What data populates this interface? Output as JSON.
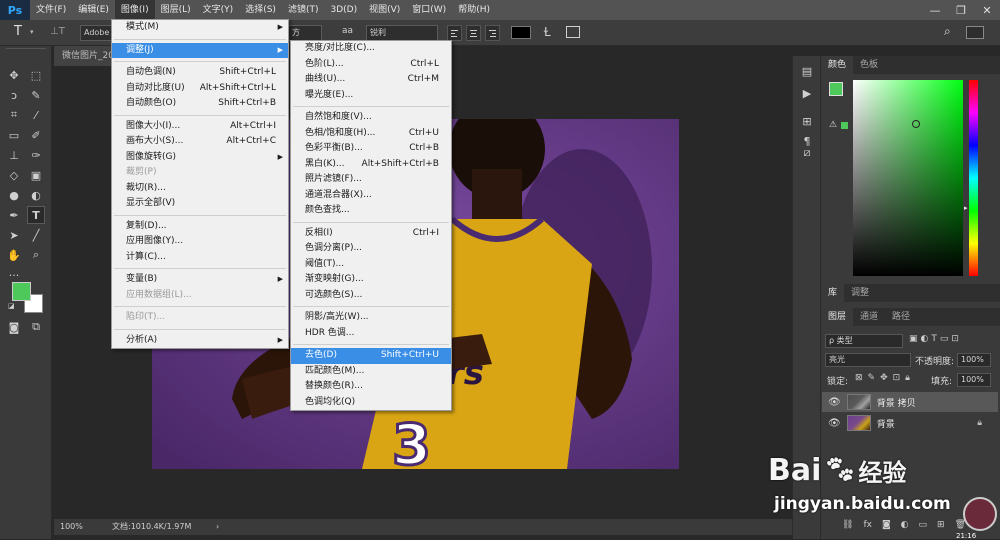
{
  "menubar": {
    "logo": "Ps",
    "items": [
      "文件(F)",
      "编辑(E)",
      "图像(I)",
      "图层(L)",
      "文字(Y)",
      "选择(S)",
      "滤镜(T)",
      "3D(D)",
      "视图(V)",
      "窗口(W)",
      "帮助(H)"
    ]
  },
  "options": {
    "tool_letter": "T",
    "font_family": "Adobe 黑",
    "font_style_partial": "方",
    "aa_icon_text": "aa",
    "antialias": "锐利"
  },
  "document": {
    "tab_title": "微信图片_20",
    "zoom": "100%",
    "doc_info": "文档:1010.4K/1.97M"
  },
  "image_menu": [
    {
      "label": "模式(M)",
      "sub": true
    },
    {
      "sep": true
    },
    {
      "label": "调整(J)",
      "sub": true,
      "hl": true
    },
    {
      "sep": true
    },
    {
      "label": "自动色调(N)",
      "sc": "Shift+Ctrl+L"
    },
    {
      "label": "自动对比度(U)",
      "sc": "Alt+Shift+Ctrl+L"
    },
    {
      "label": "自动颜色(O)",
      "sc": "Shift+Ctrl+B"
    },
    {
      "sep": true
    },
    {
      "label": "图像大小(I)...",
      "sc": "Alt+Ctrl+I"
    },
    {
      "label": "画布大小(S)...",
      "sc": "Alt+Ctrl+C"
    },
    {
      "label": "图像旋转(G)",
      "sub": true
    },
    {
      "label": "裁剪(P)",
      "dis": true
    },
    {
      "label": "裁切(R)..."
    },
    {
      "label": "显示全部(V)"
    },
    {
      "sep": true
    },
    {
      "label": "复制(D)..."
    },
    {
      "label": "应用图像(Y)..."
    },
    {
      "label": "计算(C)..."
    },
    {
      "sep": true
    },
    {
      "label": "变量(B)",
      "sub": true
    },
    {
      "label": "应用数据组(L)...",
      "dis": true
    },
    {
      "sep": true
    },
    {
      "label": "陷印(T)...",
      "dis": true
    },
    {
      "sep": true
    },
    {
      "label": "分析(A)",
      "sub": true
    }
  ],
  "adjust_menu": [
    {
      "label": "亮度/对比度(C)..."
    },
    {
      "label": "色阶(L)...",
      "sc": "Ctrl+L"
    },
    {
      "label": "曲线(U)...",
      "sc": "Ctrl+M"
    },
    {
      "label": "曝光度(E)..."
    },
    {
      "sep": true
    },
    {
      "label": "自然饱和度(V)..."
    },
    {
      "label": "色相/饱和度(H)...",
      "sc": "Ctrl+U"
    },
    {
      "label": "色彩平衡(B)...",
      "sc": "Ctrl+B"
    },
    {
      "label": "黑白(K)...",
      "sc": "Alt+Shift+Ctrl+B"
    },
    {
      "label": "照片滤镜(F)..."
    },
    {
      "label": "通道混合器(X)..."
    },
    {
      "label": "颜色查找..."
    },
    {
      "sep": true
    },
    {
      "label": "反相(I)",
      "sc": "Ctrl+I"
    },
    {
      "label": "色调分离(P)..."
    },
    {
      "label": "阈值(T)..."
    },
    {
      "label": "渐变映射(G)..."
    },
    {
      "label": "可选颜色(S)..."
    },
    {
      "sep": true
    },
    {
      "label": "阴影/高光(W)..."
    },
    {
      "label": "HDR 色调..."
    },
    {
      "sep": true
    },
    {
      "label": "去色(D)",
      "sc": "Shift+Ctrl+U",
      "hl": true
    },
    {
      "label": "匹配颜色(M)..."
    },
    {
      "label": "替换颜色(R)..."
    },
    {
      "label": "色调均化(Q)"
    }
  ],
  "color_panel": {
    "tabs": [
      "颜色",
      "色板"
    ],
    "fg": "#4ec85a",
    "bg": "#ffffff"
  },
  "library_panel": {
    "tabs": [
      "库",
      "调整"
    ]
  },
  "layers_panel": {
    "tabs": [
      "图层",
      "通道",
      "路径"
    ],
    "filter": "ρ 类型",
    "blend": "亮光",
    "opacity_label": "不透明度:",
    "opacity": "100%",
    "lock_label": "锁定:",
    "fill_label": "填充:",
    "fill": "100%",
    "layers": [
      "背景 拷贝",
      "背景"
    ],
    "bottom_icons": "fx"
  },
  "jersey": {
    "number": "3",
    "letters": "rs"
  },
  "watermark": {
    "logo": "Bai",
    "logo2": "经验",
    "url": "jingyan.baidu.com"
  },
  "clock_partial": "21:16"
}
